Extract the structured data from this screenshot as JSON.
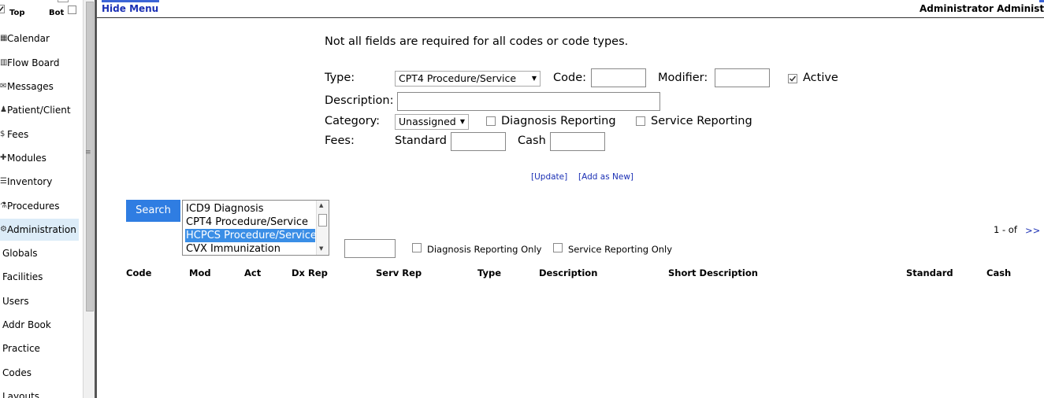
{
  "sidebar": {
    "top_label": "Top",
    "bot_label": "Bot",
    "top_checked": true,
    "bot_checked": false,
    "items": [
      {
        "label": "Calendar",
        "icon": "calendar-icon"
      },
      {
        "label": "Flow Board",
        "icon": "flow-board-icon"
      },
      {
        "label": "Messages",
        "icon": "messages-icon"
      },
      {
        "label": "Patient/Client",
        "icon": "patient-icon"
      },
      {
        "label": "Fees",
        "icon": "fees-icon"
      },
      {
        "label": "Modules",
        "icon": "modules-icon"
      },
      {
        "label": "Inventory",
        "icon": "inventory-icon"
      },
      {
        "label": "Procedures",
        "icon": "procedures-icon"
      },
      {
        "label": "Administration",
        "icon": "administration-icon"
      }
    ],
    "sub_items": [
      "Globals",
      "Facilities",
      "Users",
      "Addr Book",
      "Practice",
      "Codes",
      "Layouts"
    ]
  },
  "header": {
    "hide_menu": "Hide Menu",
    "user": "Administrator Administrator"
  },
  "form": {
    "notice": "Not all fields are required for all codes or code types.",
    "type_label": "Type:",
    "type_value": "CPT4 Procedure/Service",
    "code_label": "Code:",
    "code_value": "",
    "modifier_label": "Modifier:",
    "modifier_value": "",
    "active_label": "Active",
    "active_checked": true,
    "description_label": "Description:",
    "description_value": "",
    "category_label": "Category:",
    "category_value": "Unassigned",
    "diagnosis_reporting_label": "Diagnosis Reporting",
    "service_reporting_label": "Service Reporting",
    "fees_label": "Fees:",
    "standard_label": "Standard",
    "cash_label": "Cash",
    "update_link": "[Update]",
    "add_new_link": "[Add as New]"
  },
  "search": {
    "button_label": "Search",
    "code_types": [
      "ICD9 Diagnosis",
      "CPT4 Procedure/Service",
      "HCPCS Procedure/Service",
      "CVX Immunization"
    ],
    "selected_code_type": "HCPCS Procedure/Service",
    "search_value": "",
    "diagnosis_only_label": "Diagnosis Reporting Only",
    "service_only_label": "Service Reporting Only",
    "pager_text": "1 - of",
    "next_link": ">>"
  },
  "table": {
    "columns": [
      "Code",
      "Mod",
      "Act",
      "Dx Rep",
      "Serv Rep",
      "Type",
      "Description",
      "Short Description",
      "Standard",
      "Cash"
    ]
  },
  "colors": {
    "accent_blue": "#2f7de2",
    "link_blue": "#1a2fb4",
    "active_nav_bg": "#dcecf8",
    "selected_option_bg": "#3a8ee6"
  }
}
